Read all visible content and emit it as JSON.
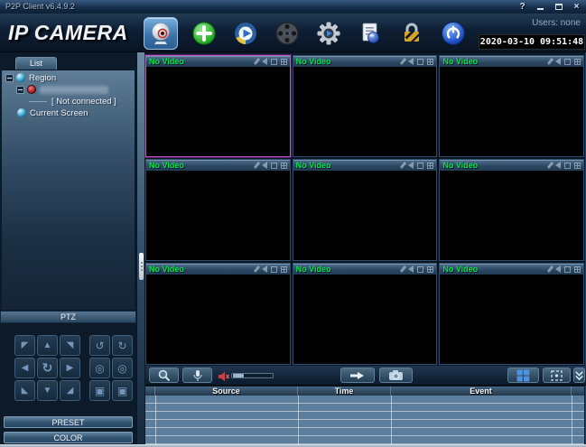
{
  "window": {
    "title": "P2P Client v6.4.9.2",
    "help_glyph": "?",
    "close_glyph": "×"
  },
  "header": {
    "logo": "IP CAMERA",
    "users_label": "Users: none",
    "datetime": "2020-03-10 09:51:48",
    "toolbar_icons": [
      "live-view",
      "add-device",
      "playback",
      "record-manager",
      "settings",
      "log",
      "lock",
      "power"
    ]
  },
  "sidebar": {
    "tab_label": "List",
    "tree": {
      "region_label": "Region",
      "not_connected_label": "[  Not connected  ]",
      "current_screen_label": "Current Screen"
    },
    "ptz": {
      "title": "PTZ",
      "preset_label": "PRESET",
      "color_label": "COLOR",
      "arrows": [
        "◤",
        "▲",
        "◥",
        "◀",
        "↻",
        "▶",
        "◣",
        "▼",
        "◢"
      ],
      "aux": [
        "↺",
        "↻",
        "◎",
        "◎",
        "▣",
        "▣"
      ]
    }
  },
  "video_grid": {
    "no_video_label": "No Video",
    "panels": 9,
    "selected_panel": 1
  },
  "bottom_toolbar": {
    "icons": [
      "zoom",
      "talk",
      "volume-muted",
      "volume-slider",
      "record",
      "snapshot",
      "screen-layout",
      "fullscreen",
      "collapse"
    ]
  },
  "event_table": {
    "columns": [
      "Source",
      "Time",
      "Event"
    ],
    "rows": []
  },
  "colors": {
    "no_video_green": "#00e44e",
    "selected_border": "#c353cb",
    "accent_blue": "#4f93e0",
    "table_body": "#5b7e9d",
    "clock_bg": "#000000"
  }
}
